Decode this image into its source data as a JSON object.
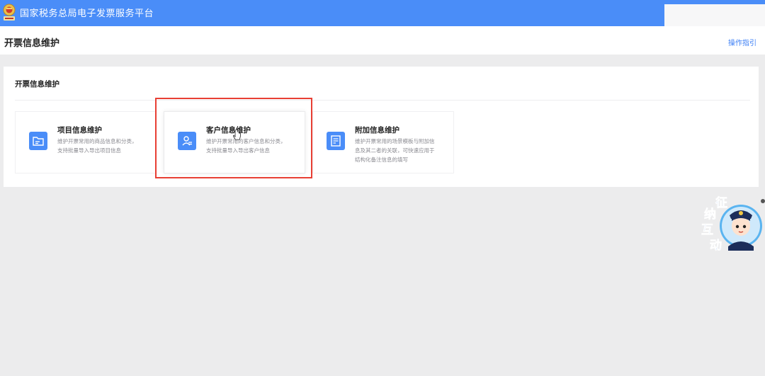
{
  "header": {
    "app_title": "国家税务总局电子发票服务平台"
  },
  "page": {
    "title": "开票信息维护",
    "guide_link": "操作指引"
  },
  "section": {
    "title": "开票信息维护"
  },
  "cards": [
    {
      "title": "项目信息维护",
      "desc_line1": "维护开票常用的商品信息和分类，",
      "desc_line2": "支持批量导入导出项目信息",
      "icon": "folder-edit-icon"
    },
    {
      "title": "客户信息维护",
      "desc_line1": "维护开票常用的客户信息和分类，",
      "desc_line2": "支持批量导入导出客户信息",
      "icon": "user-card-icon"
    },
    {
      "title": "附加信息维护",
      "desc_line1": "维护开票常用的场景模板与附加信",
      "desc_line2": "息及其二者的关联，可快速应用于",
      "desc_line3": "结构化备注信息的填写",
      "icon": "document-edit-icon"
    }
  ],
  "mascot": {
    "chars": [
      "征",
      "纳",
      "互",
      "动"
    ]
  },
  "colors": {
    "brand_blue": "#4a8df8",
    "highlight_red": "#e83f34"
  }
}
